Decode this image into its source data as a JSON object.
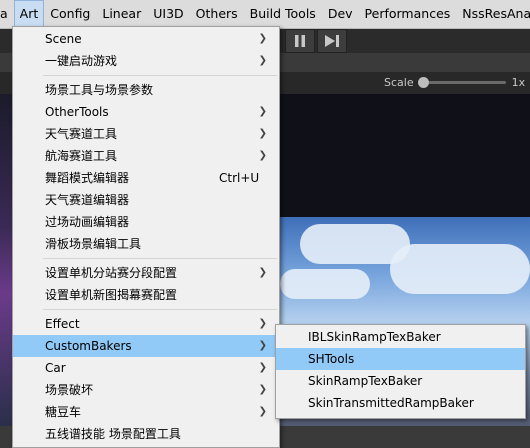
{
  "menubar": {
    "items": [
      {
        "label": "a"
      },
      {
        "label": "Art"
      },
      {
        "label": "Config"
      },
      {
        "label": "Linear"
      },
      {
        "label": "UI3D"
      },
      {
        "label": "Others"
      },
      {
        "label": "Build Tools"
      },
      {
        "label": "Dev"
      },
      {
        "label": "Performances"
      },
      {
        "label": "NssResAnaly"
      }
    ],
    "active": "Art"
  },
  "gameview": {
    "scale_label": "Scale",
    "scale_value": "1x"
  },
  "art_menu": {
    "items": [
      {
        "label": "Scene",
        "submenu": true
      },
      {
        "label": "一键启动游戏",
        "submenu": true
      },
      {
        "label": "场景工具与场景参数",
        "submenu": false
      },
      {
        "label": "OtherTools",
        "submenu": true
      },
      {
        "label": "天气赛道工具",
        "submenu": true
      },
      {
        "label": "航海赛道工具",
        "submenu": true
      },
      {
        "label": "舞蹈模式编辑器",
        "submenu": false,
        "shortcut": "Ctrl+U"
      },
      {
        "label": "天气赛道编辑器",
        "submenu": false
      },
      {
        "label": "过场动画编辑器",
        "submenu": false
      },
      {
        "label": "滑板场景编辑工具",
        "submenu": false
      },
      {
        "label": "设置单机分站赛分段配置",
        "submenu": true
      },
      {
        "label": "设置单机新图揭幕赛配置",
        "submenu": false
      },
      {
        "label": "Effect",
        "submenu": true
      },
      {
        "label": "CustomBakers",
        "submenu": true,
        "highlighted": true
      },
      {
        "label": "Car",
        "submenu": true
      },
      {
        "label": "场景破坏",
        "submenu": true
      },
      {
        "label": "糖豆车",
        "submenu": true
      },
      {
        "label": "五线谱技能 场景配置工具",
        "submenu": false
      }
    ]
  },
  "custom_bakers_menu": {
    "items": [
      {
        "label": "IBLSkinRampTexBaker"
      },
      {
        "label": "SHTools",
        "highlighted": true
      },
      {
        "label": "SkinRampTexBaker"
      },
      {
        "label": "SkinTransmittedRampBaker"
      }
    ]
  },
  "colors": {
    "menu_bg": "#f0f0f0",
    "highlight": "#91c9f7",
    "menubar_bg": "#dcdcdc"
  }
}
